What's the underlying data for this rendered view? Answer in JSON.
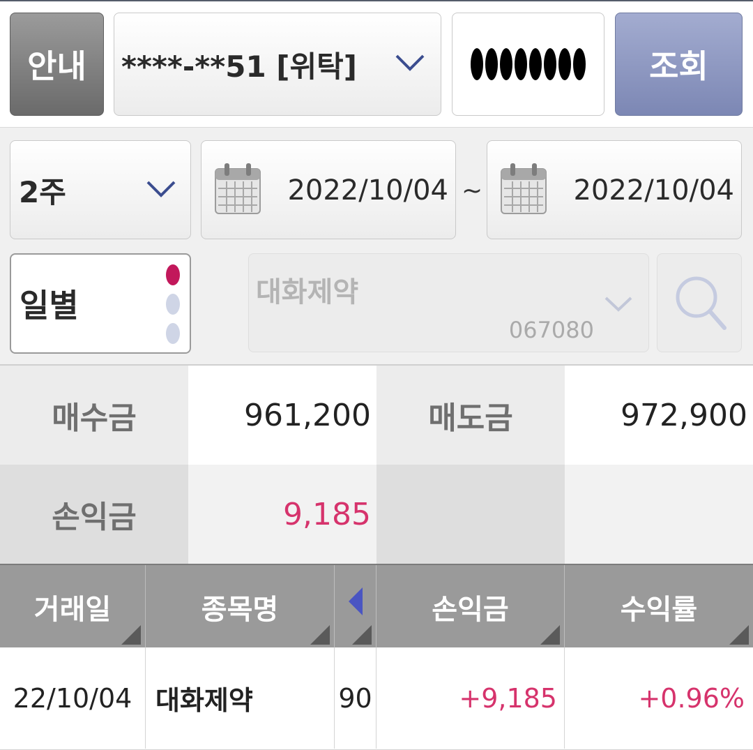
{
  "top_bar": {
    "info_label": "안내",
    "account_number": "****-**51 [위탁]",
    "password_masked": "●●●●●●●●",
    "query_label": "조회"
  },
  "filters": {
    "period": "2주",
    "start_date": "2022/10/04",
    "range_separator": "~",
    "end_date": "2022/10/04",
    "view_mode": "일별",
    "view_mode_options_count": 3,
    "view_mode_selected_index": 0,
    "stock_name": "대화제약",
    "stock_code": "067080"
  },
  "summary": {
    "buy_label": "매수금",
    "buy_value": "961,200",
    "sell_label": "매도금",
    "sell_value": "972,900",
    "pnl_label": "손익금",
    "pnl_value": "9,185"
  },
  "table": {
    "headers": [
      "거래일",
      "종목명",
      "손익금",
      "수익률"
    ],
    "rows": [
      {
        "date": "22/10/04",
        "name": "대화제약",
        "qty": "90",
        "pnl": "+9,185",
        "rate": "+0.96%"
      }
    ]
  },
  "colors": {
    "positive": "#d6336c",
    "query_button": "#8d97c2",
    "info_button": "#7e7e7e",
    "header_bg": "#9a9a9a",
    "indicator_active": "#c2185b",
    "indicator_inactive": "#cfd5e6"
  }
}
